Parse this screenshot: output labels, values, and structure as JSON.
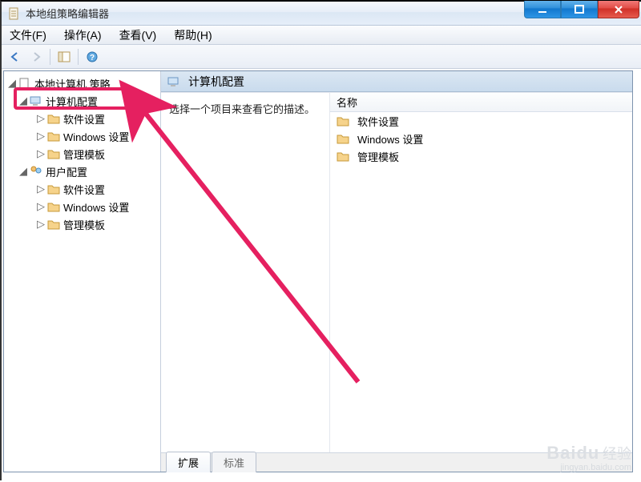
{
  "window": {
    "title": "本地组策略编辑器"
  },
  "menu": {
    "file": "文件(F)",
    "action": "操作(A)",
    "view": "查看(V)",
    "help": "帮助(H)"
  },
  "tree": {
    "root": "本地计算机 策略",
    "computer": "计算机配置",
    "user": "用户配置",
    "children": {
      "software": "软件设置",
      "windows": "Windows 设置",
      "templates": "管理模板"
    }
  },
  "rightPane": {
    "headerTitle": "计算机配置",
    "description": "选择一个项目来查看它的描述。",
    "column": "名称",
    "items": {
      "software": "软件设置",
      "windows": "Windows 设置",
      "templates": "管理模板"
    }
  },
  "tabs": {
    "extended": "扩展",
    "standard": "标准"
  },
  "watermark": {
    "brand_en": "Baidu",
    "brand_cn": "经验",
    "url": "jingyan.baidu.com"
  }
}
